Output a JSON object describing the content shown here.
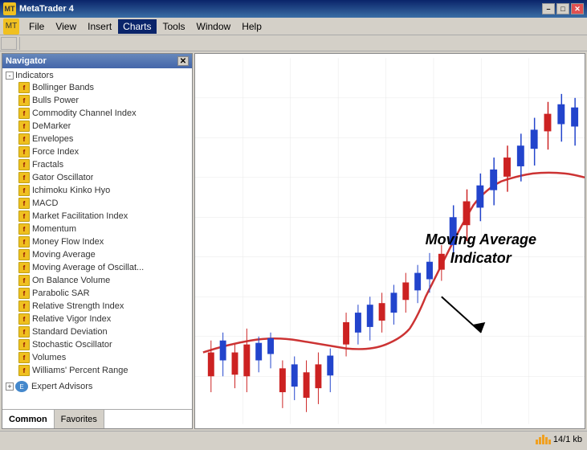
{
  "title_bar": {
    "title": "MetaTrader 4",
    "icon": "MT",
    "minimize": "–",
    "maximize": "□",
    "close": "✕"
  },
  "menu": {
    "app_icon": "MT",
    "items": [
      "File",
      "View",
      "Insert",
      "Charts",
      "Tools",
      "Window",
      "Help"
    ],
    "active": "Charts"
  },
  "navigator": {
    "title": "Navigator",
    "sections": [
      {
        "name": "Indicators",
        "items": [
          "Bollinger Bands",
          "Bulls Power",
          "Commodity Channel Index",
          "DeMarker",
          "Envelopes",
          "Force Index",
          "Fractals",
          "Gator Oscillator",
          "Ichimoku Kinko Hyo",
          "MACD",
          "Market Facilitation Index",
          "Momentum",
          "Money Flow Index",
          "Moving Average",
          "Moving Average of Oscillat...",
          "On Balance Volume",
          "Parabolic SAR",
          "Relative Strength Index",
          "Relative Vigor Index",
          "Standard Deviation",
          "Stochastic Oscillator",
          "Volumes",
          "Williams' Percent Range"
        ]
      }
    ],
    "tabs": [
      "Common",
      "Favorites"
    ],
    "active_tab": "Common"
  },
  "chart": {
    "annotation_line1": "Moving Average",
    "annotation_line2": "Indicator"
  },
  "status": {
    "bars_label": "14/1 kb"
  }
}
